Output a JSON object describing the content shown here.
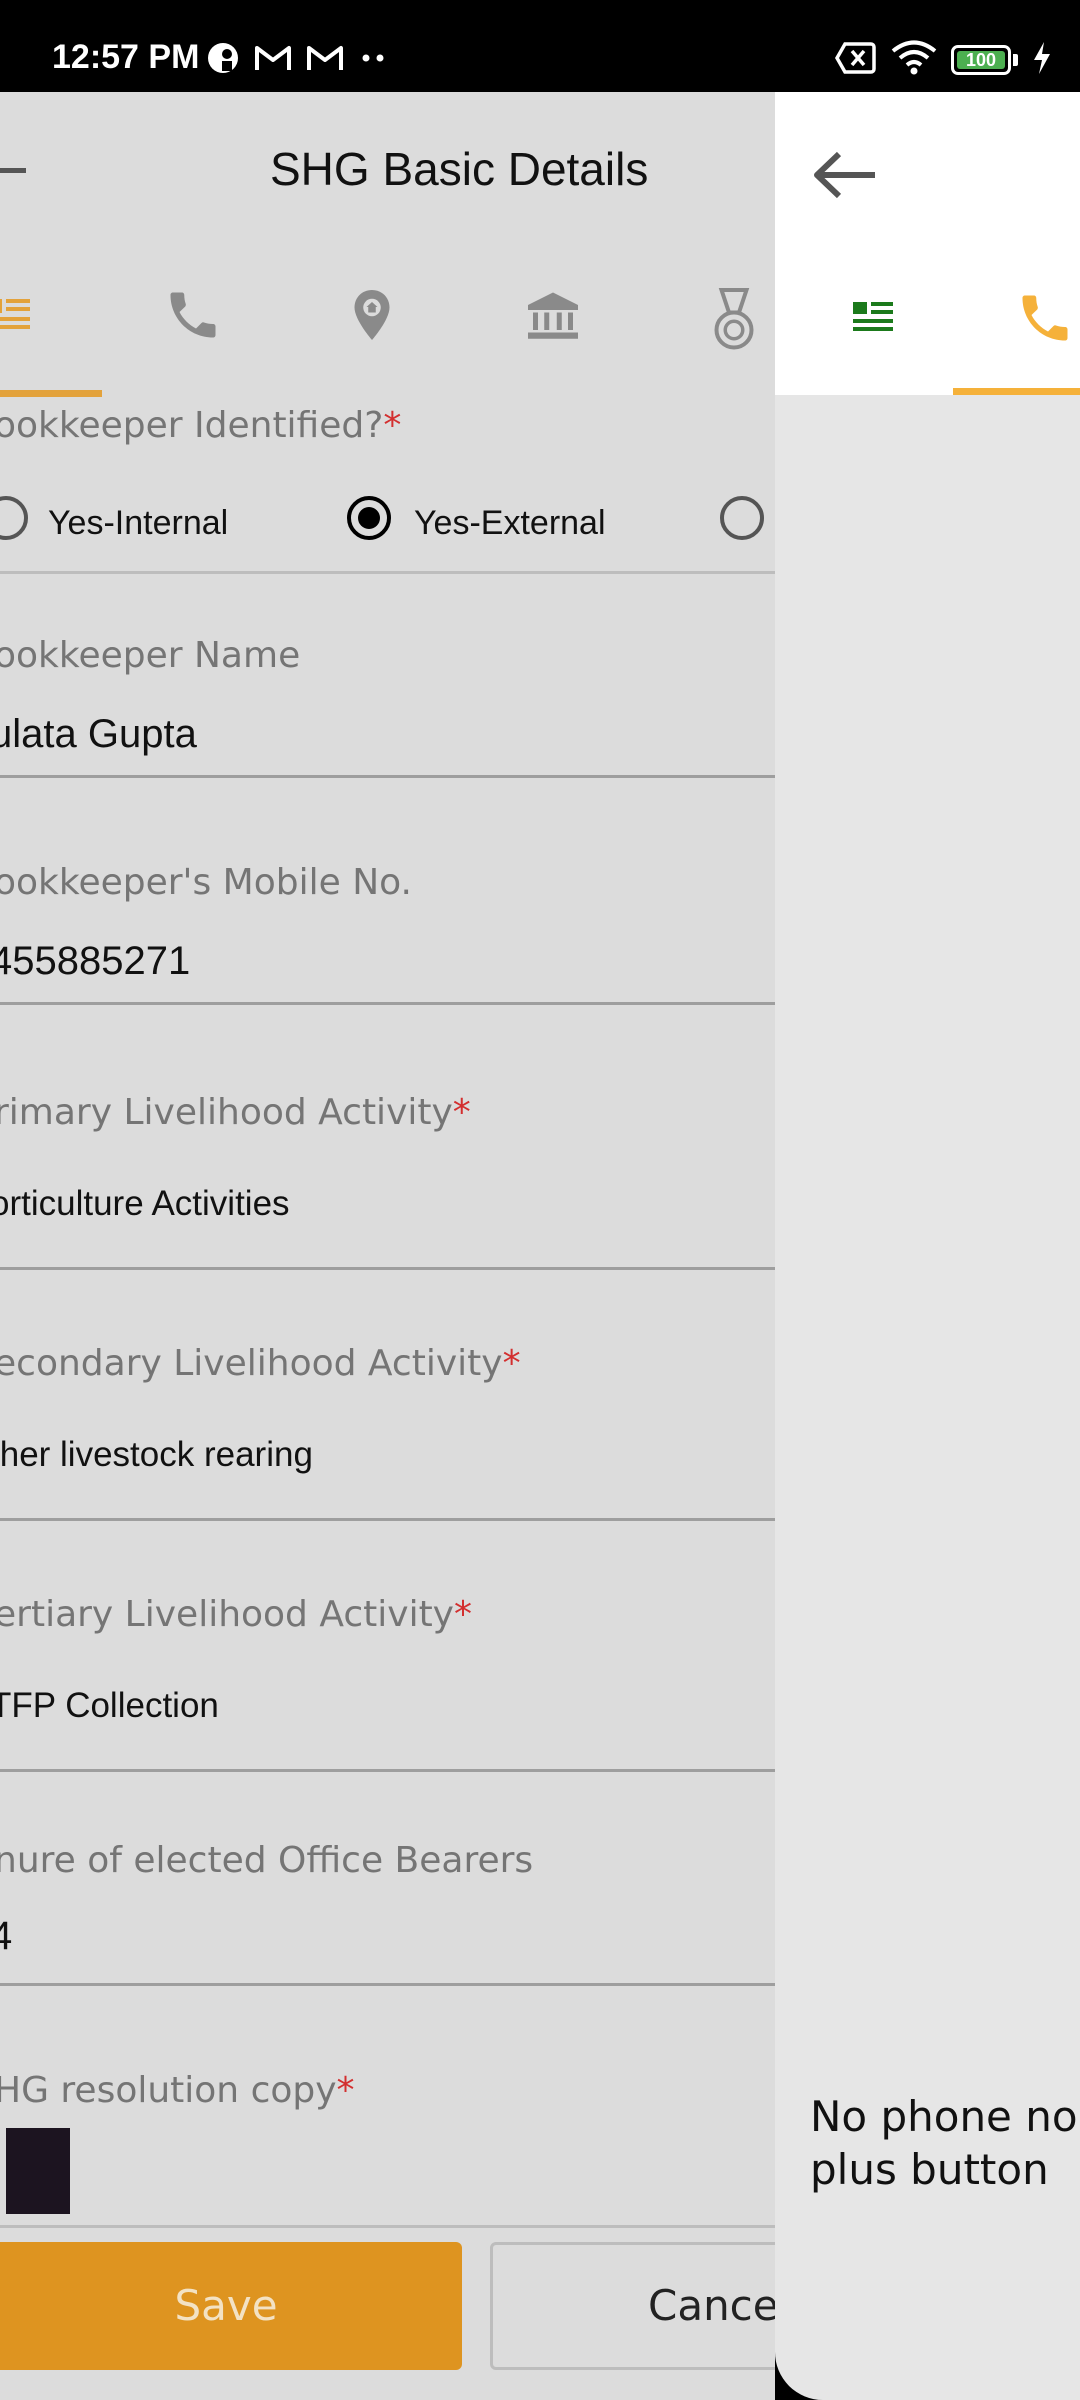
{
  "status_bar": {
    "time": "12:57 PM",
    "battery_level": "100",
    "icons_left": [
      "profile-icon",
      "gmail-icon",
      "gmail-icon",
      "more-dots-icon"
    ],
    "icons_right": [
      "sim-off-icon",
      "wifi-icon",
      "battery-icon",
      "charging-icon"
    ]
  },
  "background_screen": {
    "title": "SHG Basic Details",
    "tabs": [
      "details-icon",
      "phone-icon",
      "location-icon",
      "bank-icon",
      "medal-icon"
    ],
    "bookkeeper_identified": {
      "label": "ookkeeper Identified?",
      "required": "*",
      "options": [
        "Yes-Internal",
        "Yes-External",
        ""
      ],
      "selected": "Yes-External"
    },
    "fields": {
      "bookkeeper_name": {
        "label": "ookkeeper Name",
        "value": "ulata Gupta"
      },
      "bookkeeper_mobile": {
        "label": "ookkeeper's Mobile No.",
        "value": "455885271"
      },
      "primary_livelihood": {
        "label": "rimary Livelihood Activity",
        "required": "*",
        "value": "orticulture Activities"
      },
      "secondary_livelihood": {
        "label": "econdary Livelihood Activity",
        "required": "*",
        "value": "ther livestock rearing"
      },
      "tertiary_livelihood": {
        "label": "ertiary Livelihood Activity",
        "required": "*",
        "value": "TFP Collection"
      },
      "tenure": {
        "label": "nure of elected Office Bearers",
        "value": "4"
      },
      "resolution_copy": {
        "label": "HG resolution copy",
        "required": "*"
      }
    },
    "buttons": {
      "save": "Save",
      "cancel": "Cance"
    }
  },
  "drawer": {
    "tabs": [
      "details-icon",
      "phone-icon"
    ],
    "active_tab": "phone-icon",
    "message_line1": "No phone no",
    "message_line2": "plus button"
  },
  "colors": {
    "accent": "#de9420",
    "drawer_accent": "#f5b13a",
    "green_icon": "#1b7a1b",
    "required": "#d32f2f"
  }
}
